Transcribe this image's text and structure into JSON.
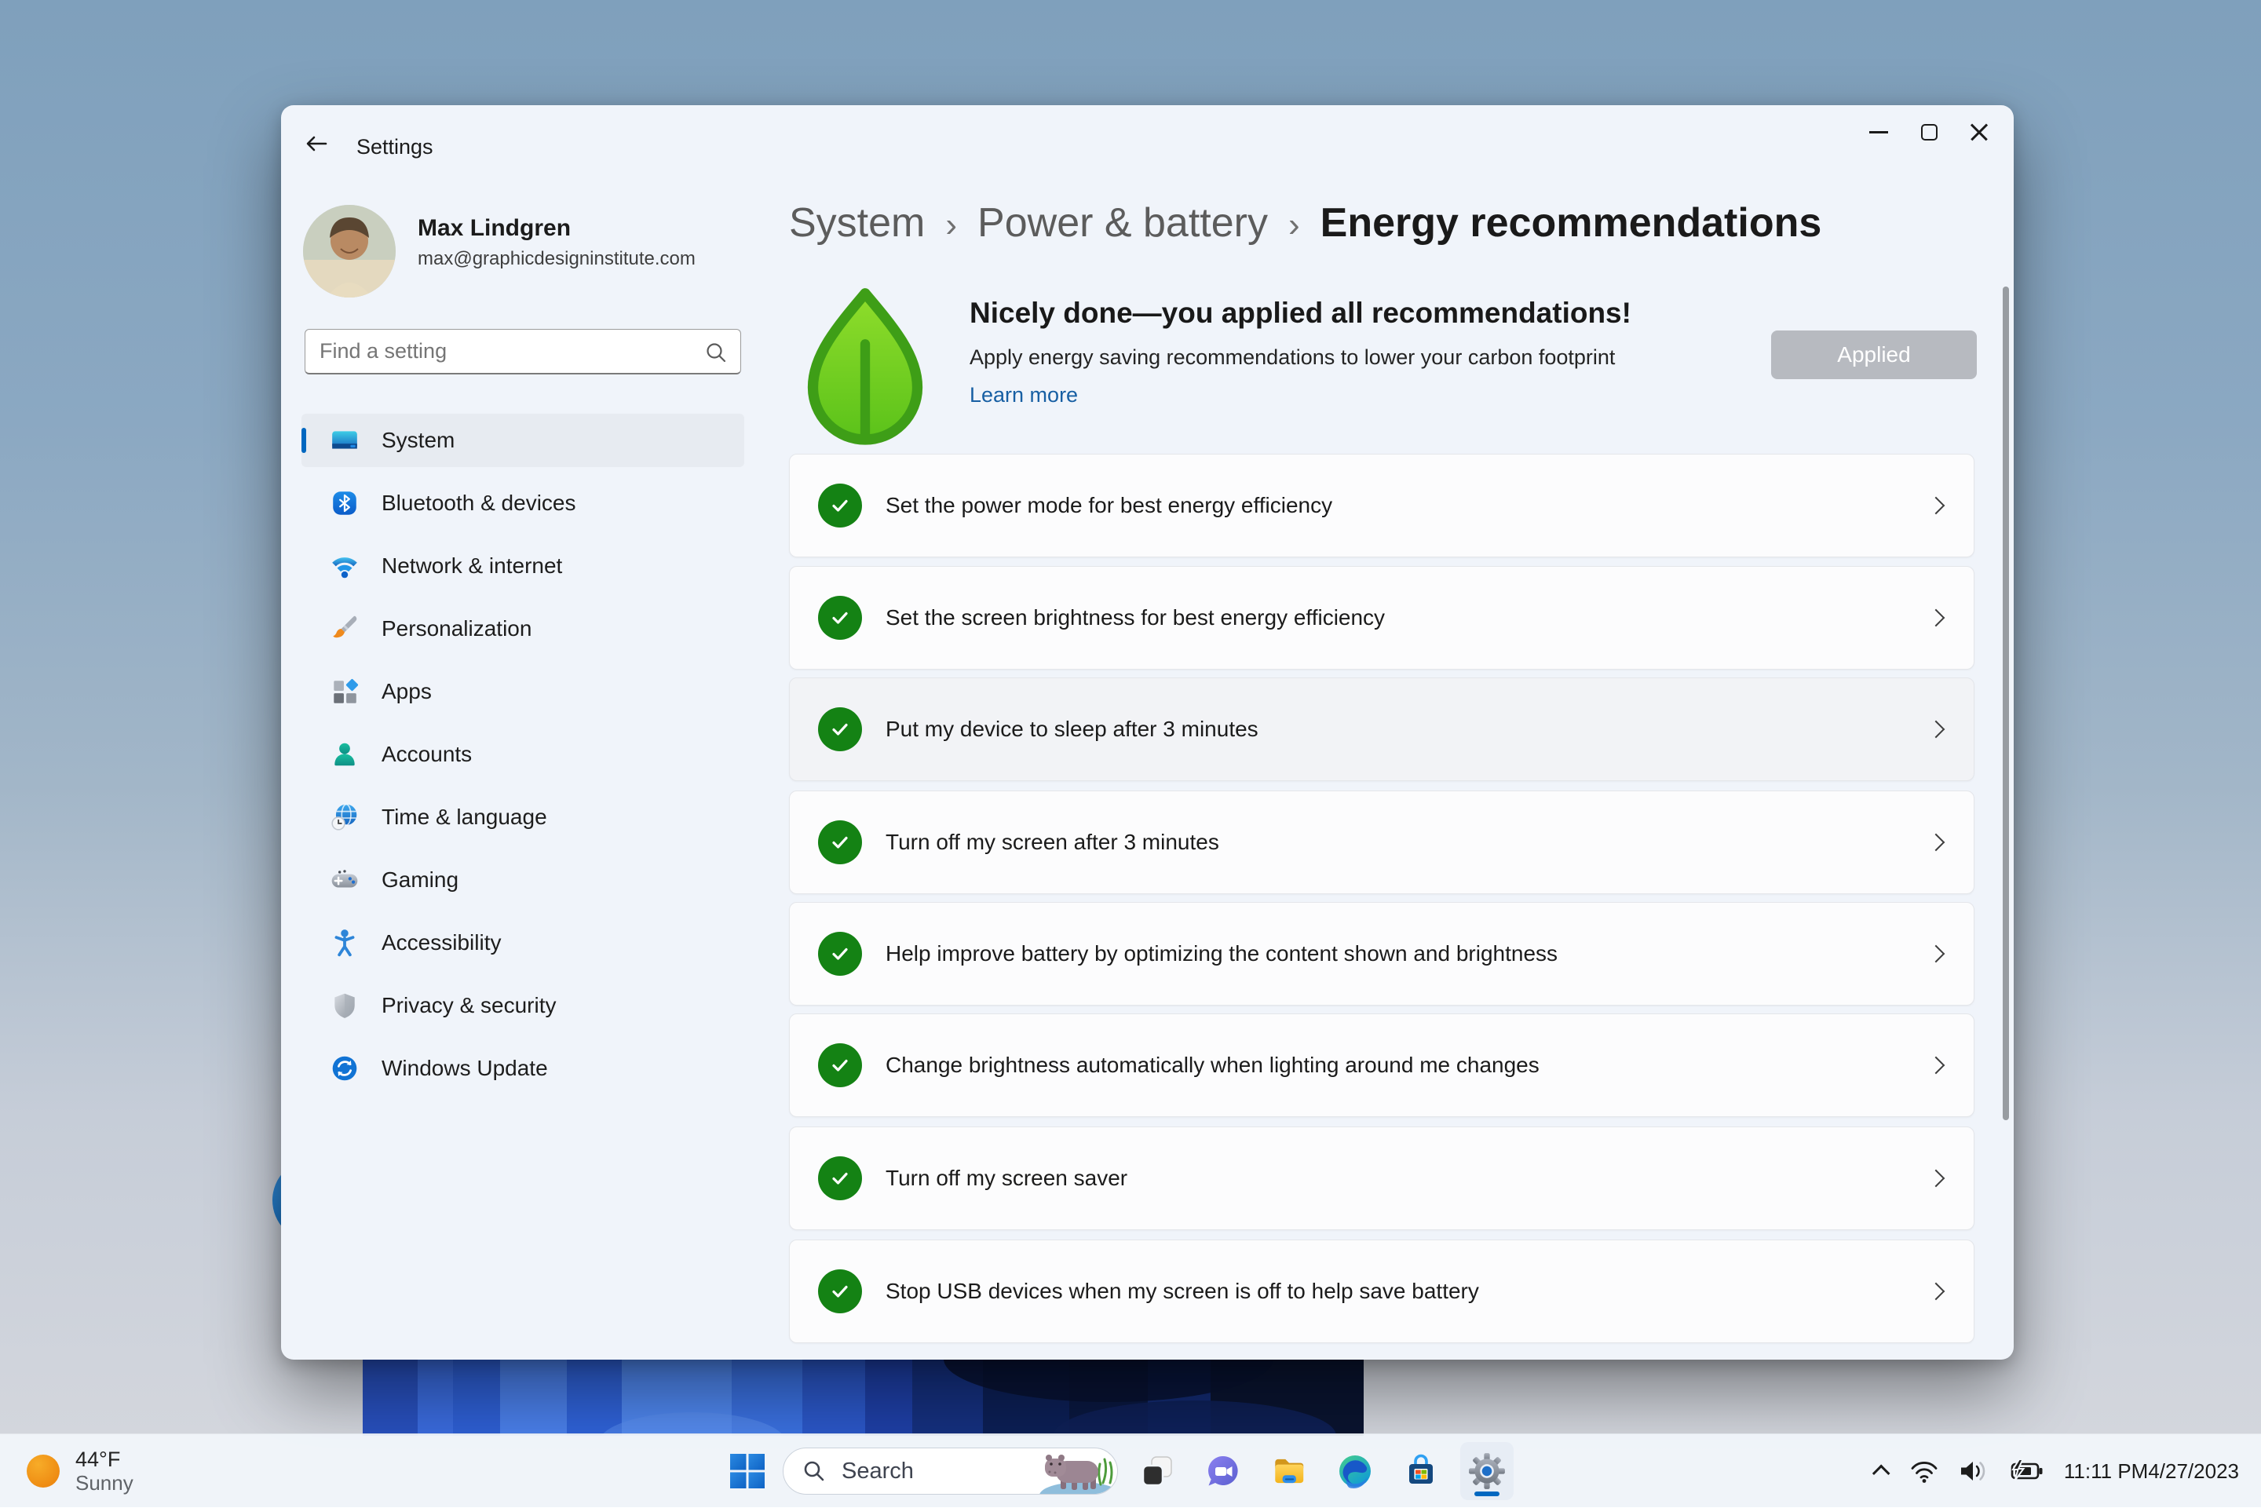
{
  "app": {
    "title": "Settings"
  },
  "window_controls": {
    "minimize": "minimize",
    "maximize": "maximize",
    "close": "close"
  },
  "profile": {
    "name": "Max Lindgren",
    "email": "max@graphicdesigninstitute.com"
  },
  "search": {
    "placeholder": "Find a setting"
  },
  "sidebar": {
    "selected": "System",
    "items": [
      {
        "label": "System"
      },
      {
        "label": "Bluetooth & devices"
      },
      {
        "label": "Network & internet"
      },
      {
        "label": "Personalization"
      },
      {
        "label": "Apps"
      },
      {
        "label": "Accounts"
      },
      {
        "label": "Time & language"
      },
      {
        "label": "Gaming"
      },
      {
        "label": "Accessibility"
      },
      {
        "label": "Privacy & security"
      },
      {
        "label": "Windows Update"
      }
    ]
  },
  "breadcrumb": {
    "separator": "›",
    "parts": [
      "System",
      "Power & battery",
      "Energy recommendations"
    ]
  },
  "hero": {
    "title": "Nicely done—you applied all recommendations!",
    "subtitle": "Apply energy saving recommendations to lower your carbon footprint",
    "link_label": "Learn more",
    "button_label": "Applied"
  },
  "recommendations": [
    {
      "label": "Set the power mode for best energy efficiency",
      "status": "applied"
    },
    {
      "label": "Set the screen brightness for best energy efficiency",
      "status": "applied"
    },
    {
      "label": "Put my device to sleep after 3 minutes",
      "status": "applied"
    },
    {
      "label": "Turn off my screen after 3 minutes",
      "status": "applied"
    },
    {
      "label": "Help improve battery by optimizing the content shown and brightness",
      "status": "applied"
    },
    {
      "label": "Change brightness automatically when lighting around me changes",
      "status": "applied"
    },
    {
      "label": "Turn off my screen saver",
      "status": "applied"
    },
    {
      "label": "Stop USB devices when my screen is off to help save battery",
      "status": "applied"
    }
  ],
  "taskbar": {
    "weather": {
      "temp": "44°F",
      "condition": "Sunny"
    },
    "search_label": "Search",
    "apps": [
      "task-view",
      "chat",
      "file-explorer",
      "edge",
      "store",
      "settings"
    ],
    "active_app": "settings",
    "tray": {
      "time": "11:11 PM",
      "date": "4/27/2023"
    }
  },
  "colors": {
    "accent": "#0067C0",
    "success_green": "#148214",
    "leaf_green": "#5BC21A",
    "applied_gray": "#B7BAC0"
  }
}
